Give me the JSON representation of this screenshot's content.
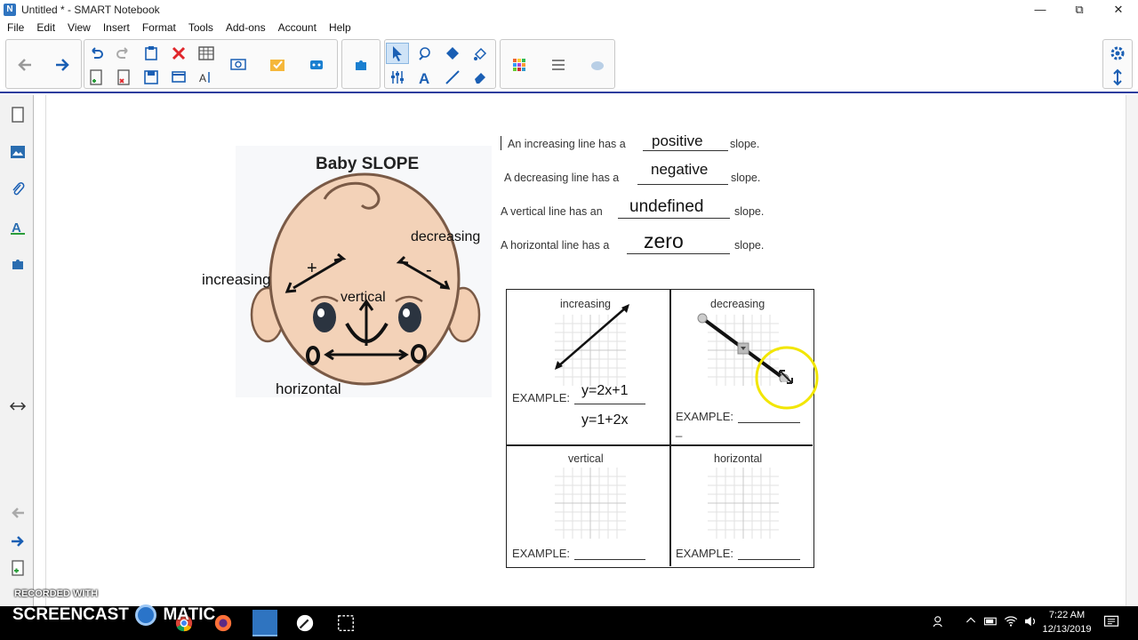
{
  "window": {
    "title": "Untitled * - SMART Notebook"
  },
  "menu": [
    "File",
    "Edit",
    "View",
    "Insert",
    "Format",
    "Tools",
    "Add-ons",
    "Account",
    "Help"
  ],
  "worksheet": {
    "picture_title": "Baby SLOPE",
    "face_labels": {
      "increasing": "increasing",
      "decreasing": "decreasing",
      "vertical": "vertical",
      "horizontal": "horizontal",
      "plus": "+",
      "minus": "-",
      "zero_left": "0",
      "zero_right": "0"
    },
    "sentences": [
      {
        "before": "An increasing line has a",
        "answer": "positive",
        "after": "slope."
      },
      {
        "before": "A decreasing line has a",
        "answer": "negative",
        "after": "slope."
      },
      {
        "before": "A vertical line has an",
        "answer": "undefined",
        "after": "slope."
      },
      {
        "before": "A horizontal line has a",
        "answer": "zero",
        "after": "slope."
      }
    ],
    "cells": [
      {
        "title": "increasing",
        "example_label": "EXAMPLE:",
        "answers": [
          "y=2x+1",
          "y=1+2x"
        ]
      },
      {
        "title": "decreasing",
        "example_label": "EXAMPLE:",
        "dash": "_"
      },
      {
        "title": "vertical",
        "example_label": "EXAMPLE:"
      },
      {
        "title": "horizontal",
        "example_label": "EXAMPLE:"
      }
    ]
  },
  "watermark": {
    "small": "RECORDED WITH",
    "brand_left": "SCREENCAST",
    "brand_right": "MATIC"
  },
  "tray": {
    "time": "7:22 AM",
    "date": "12/13/2019"
  },
  "colors": {
    "accent": "#2d3d9e",
    "highlight": "#f2e600"
  }
}
